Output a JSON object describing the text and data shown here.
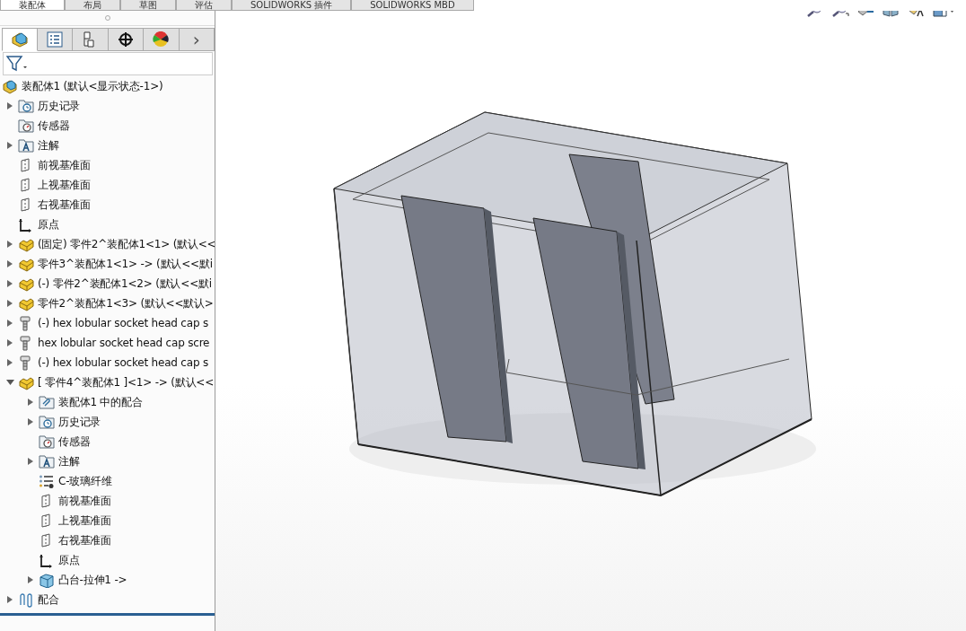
{
  "ribbon_tabs": [
    {
      "label": "装配体",
      "selected": true
    },
    {
      "label": "布局",
      "selected": false
    },
    {
      "label": "草图",
      "selected": false
    },
    {
      "label": "评估",
      "selected": false
    },
    {
      "label": "SOLIDWORKS 插件",
      "selected": false
    },
    {
      "label": "SOLIDWORKS MBD",
      "selected": false
    }
  ],
  "panel_tabs": [
    {
      "kind": "feature-tree",
      "selected": true
    },
    {
      "kind": "properties",
      "selected": false
    },
    {
      "kind": "configurations",
      "selected": false
    },
    {
      "kind": "dimxpert",
      "selected": false
    },
    {
      "kind": "appearance",
      "selected": false
    }
  ],
  "panel_more": "›",
  "tree_root": {
    "label": "装配体1  (默认<显示状态-1>)",
    "kind": "assembly"
  },
  "tree": [
    {
      "label": "历史记录",
      "kind": "history",
      "expandable": true,
      "expanded": false
    },
    {
      "label": "传感器",
      "kind": "sensor",
      "expandable": false
    },
    {
      "label": "注解",
      "kind": "annotation",
      "expandable": true,
      "expanded": false
    },
    {
      "label": "前视基准面",
      "kind": "plane",
      "expandable": false
    },
    {
      "label": "上视基准面",
      "kind": "plane",
      "expandable": false
    },
    {
      "label": "右视基准面",
      "kind": "plane",
      "expandable": false
    },
    {
      "label": "原点",
      "kind": "origin",
      "expandable": false
    },
    {
      "label": "(固定) 零件2^装配体1<1> (默认<<",
      "kind": "part",
      "expandable": true,
      "expanded": false
    },
    {
      "label": "零件3^装配体1<1> -> (默认<<默i",
      "kind": "part",
      "expandable": true,
      "expanded": false
    },
    {
      "label": "(-) 零件2^装配体1<2> (默认<<默i",
      "kind": "part",
      "expandable": true,
      "expanded": false
    },
    {
      "label": "零件2^装配体1<3> (默认<<默认>",
      "kind": "part",
      "expandable": true,
      "expanded": false
    },
    {
      "label": "(-) hex lobular socket head cap s",
      "kind": "screw",
      "expandable": true,
      "expanded": false
    },
    {
      "label": "hex lobular socket head cap scre",
      "kind": "screw",
      "expandable": true,
      "expanded": false
    },
    {
      "label": "(-) hex lobular socket head cap s",
      "kind": "screw",
      "expandable": true,
      "expanded": false
    },
    {
      "label": "[ 零件4^装配体1 ]<1> -> (默认<<",
      "kind": "part",
      "expandable": true,
      "expanded": true,
      "children": [
        {
          "label": "装配体1 中的配合",
          "kind": "mates-folder",
          "expandable": true,
          "expanded": false
        },
        {
          "label": "历史记录",
          "kind": "history",
          "expandable": true,
          "expanded": false
        },
        {
          "label": "传感器",
          "kind": "sensor",
          "expandable": false
        },
        {
          "label": "注解",
          "kind": "annotation",
          "expandable": true,
          "expanded": false
        },
        {
          "label": "C-玻璃纤维",
          "kind": "material",
          "expandable": false
        },
        {
          "label": "前视基准面",
          "kind": "plane",
          "expandable": false
        },
        {
          "label": "上视基准面",
          "kind": "plane",
          "expandable": false
        },
        {
          "label": "右视基准面",
          "kind": "plane",
          "expandable": false
        },
        {
          "label": "原点",
          "kind": "origin",
          "expandable": false
        },
        {
          "label": "凸台-拉伸1 ->",
          "kind": "extrude",
          "expandable": true,
          "expanded": false
        }
      ]
    },
    {
      "label": "配合",
      "kind": "mates",
      "expandable": true,
      "expanded": false
    }
  ]
}
